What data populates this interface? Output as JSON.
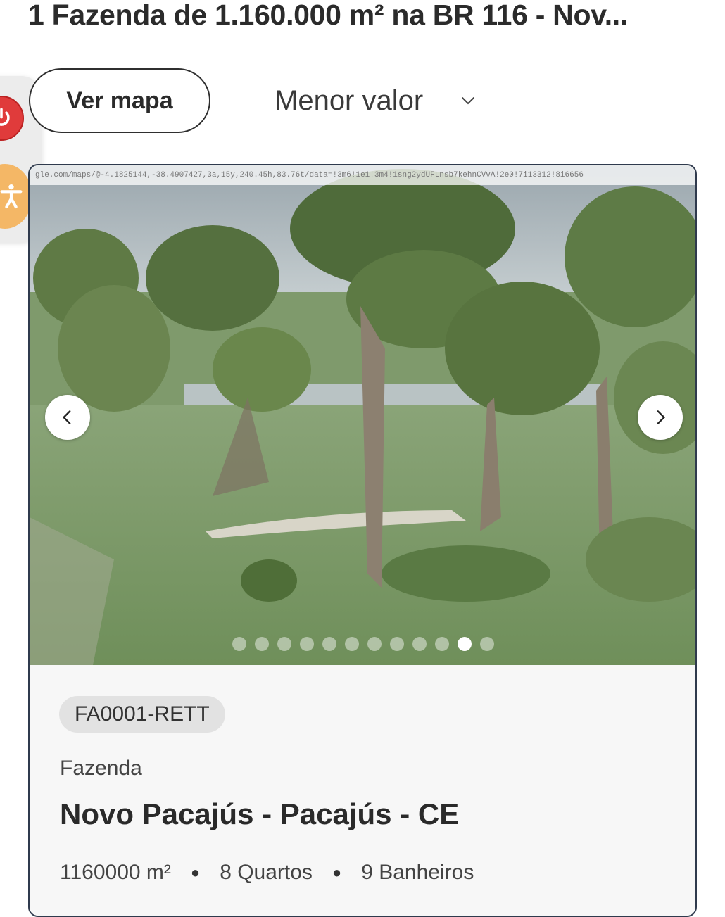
{
  "header": {
    "title": "1 Fazenda de 1.160.000 m² na BR 116 - Nov..."
  },
  "toolbar": {
    "map_button_label": "Ver mapa",
    "sort_selected": "Menor valor"
  },
  "listing": {
    "url_overlay": "gle.com/maps/@-4.1825144,-38.4907427,3a,15y,240.45h,83.76t/data=!3m6!1e1!3m4!1sng2ydUFLnsb7kehnCVvA!2e0!7i13312!8i6656",
    "carousel": {
      "total_slides": 12,
      "active_slide": 11
    },
    "code": "FA0001-RETT",
    "type": "Fazenda",
    "location": "Novo Pacajús - Pacajús - CE",
    "area": "1160000 m²",
    "bedrooms": "8 Quartos",
    "bathrooms": "9 Banheiros"
  },
  "colors": {
    "power_button": "#e03b3b",
    "accessibility_button": "#f4b766",
    "card_border": "#2f3a4d"
  },
  "icons": [
    "power-icon",
    "accessibility-icon",
    "chevron-down-icon",
    "chevron-left-icon",
    "chevron-right-icon"
  ]
}
